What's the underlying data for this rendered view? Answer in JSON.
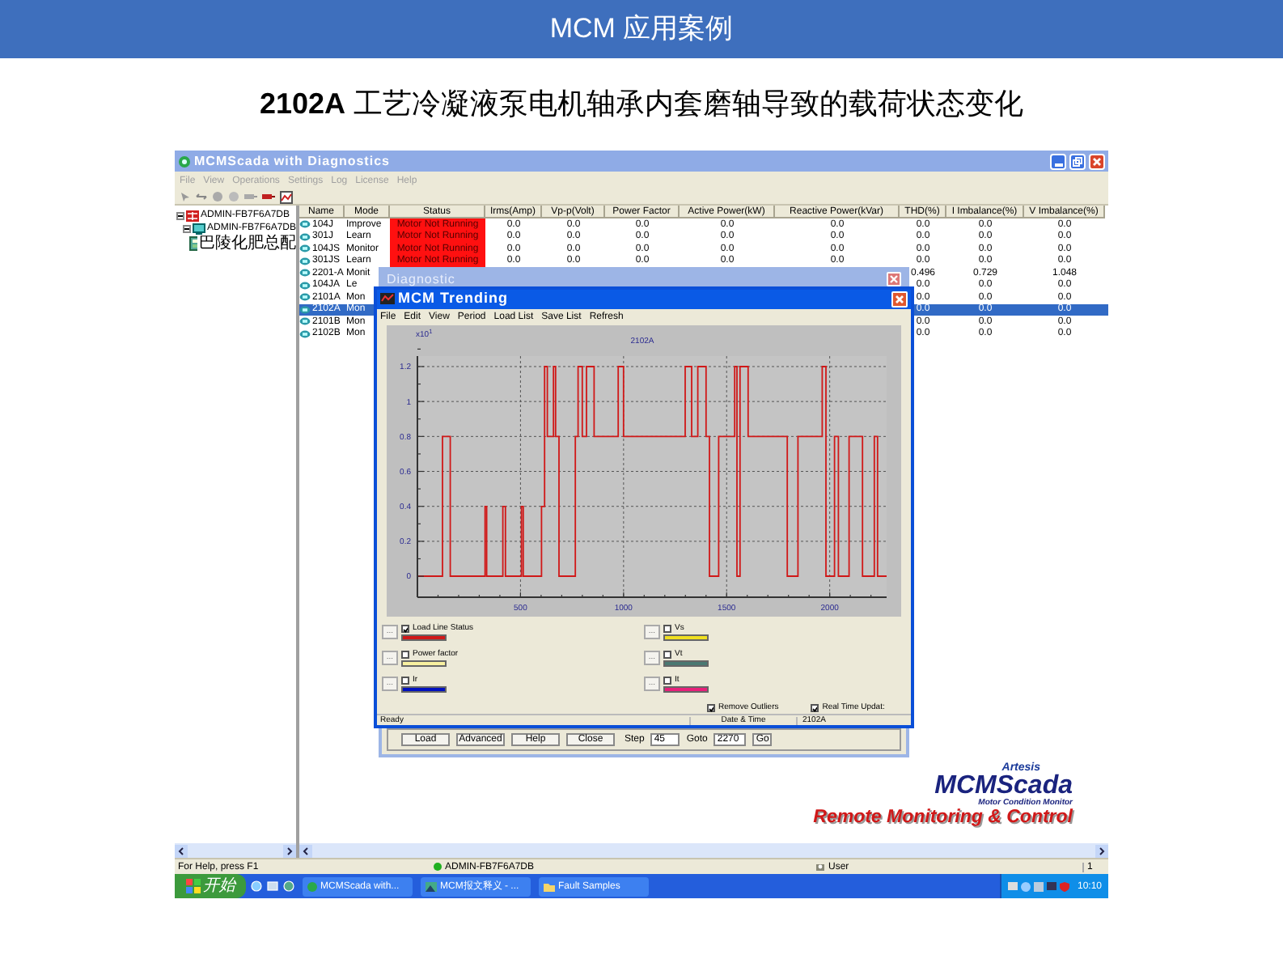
{
  "slide": {
    "title": "MCM 应用案例",
    "subtitle": "**2102A** 工艺冷凝液泵电机轴承内套磨轴导致的载荷状态变化"
  },
  "window": {
    "title": "MCMScada with Diagnostics"
  },
  "menu": [
    {
      "label": "File",
      "disabled": true
    },
    {
      "label": "View",
      "disabled": true
    },
    {
      "label": "Operations",
      "disabled": true
    },
    {
      "label": "Settings",
      "disabled": true
    },
    {
      "label": "Log",
      "disabled": true
    },
    {
      "label": "License",
      "disabled": true
    },
    {
      "label": "Help",
      "disabled": true
    }
  ],
  "tree": [
    {
      "label": "ADMIN-FB7F6A7DB",
      "expanded": true,
      "children": [
        {
          "label": "ADMIN-FB7F6A7DB",
          "expanded": true,
          "children": [
            {
              "label": "巴陵化肥总配"
            }
          ]
        }
      ]
    }
  ],
  "table": {
    "columns": [
      "Name",
      "Mode",
      "Status",
      "Irms(Amp)",
      "Vp-p(Volt)",
      "Power Factor",
      "Active Power(kW)",
      "Reactive Power(kVar)",
      "THD(%)",
      "I Imbalance(%)",
      "V Imbalance(%)"
    ],
    "rows": [
      {
        "name": "104J",
        "mode": "Improve",
        "status": "Motor Not Running",
        "alarm": true,
        "values": [
          "0.0",
          "0.0",
          "0.0",
          "0.0",
          "0.0",
          "0.0",
          "0.0",
          "0.0"
        ],
        "selected": false
      },
      {
        "name": "301J",
        "mode": "Learn",
        "status": "Motor Not Running",
        "alarm": true,
        "values": [
          "0.0",
          "0.0",
          "0.0",
          "0.0",
          "0.0",
          "0.0",
          "0.0",
          "0.0"
        ],
        "selected": false
      },
      {
        "name": "104JS",
        "mode": "Monitor",
        "status": "Motor Not Running",
        "alarm": true,
        "values": [
          "0.0",
          "0.0",
          "0.0",
          "0.0",
          "0.0",
          "0.0",
          "0.0",
          "0.0"
        ],
        "selected": false
      },
      {
        "name": "301JS",
        "mode": "Learn",
        "status": "Motor Not Running",
        "alarm": true,
        "values": [
          "0.0",
          "0.0",
          "0.0",
          "0.0",
          "0.0",
          "0.0",
          "0.0",
          "0.0"
        ],
        "selected": false
      },
      {
        "name": "2201-A",
        "mode": "Monit",
        "tail": [
          "0.496",
          "0.729",
          "1.048"
        ],
        "selected": false
      },
      {
        "name": "104JA",
        "mode": "Le",
        "tail": [
          "0.0",
          "0.0",
          "0.0"
        ],
        "selected": false
      },
      {
        "name": "2101A",
        "mode": "Mon",
        "tail": [
          "0.0",
          "0.0",
          "0.0"
        ],
        "selected": false
      },
      {
        "name": "2102A",
        "mode": "Mon",
        "tail": [
          "0.0",
          "0.0",
          "0.0"
        ],
        "selected": true
      },
      {
        "name": "2101B",
        "mode": "Mon",
        "tail": [
          "0.0",
          "0.0",
          "0.0"
        ],
        "selected": false
      },
      {
        "name": "2102B",
        "mode": "Mon",
        "tail": [
          "0.0",
          "0.0",
          "0.0"
        ],
        "selected": false
      }
    ]
  },
  "diagnostic": {
    "title": "Diagnostic",
    "buttons": [
      "Load",
      "Advanced",
      "Help",
      "Close"
    ],
    "step": {
      "label": "Step",
      "value": "45"
    },
    "goto": {
      "label": "Goto",
      "value": "2270"
    },
    "go": "Go"
  },
  "trending": {
    "title": "MCM Trending",
    "menu": [
      "File",
      "Edit",
      "View",
      "Period",
      "Load List",
      "Save List",
      "Refresh"
    ],
    "chart_data": {
      "type": "line",
      "grid": true,
      "title": "2102A",
      "ylabel": "x10$^{1}$",
      "xlim": [
        0,
        2276
      ],
      "ylim": [
        -0.12,
        1.26
      ],
      "xticks": [
        500,
        1000,
        1500,
        2000
      ],
      "yticks": [
        0,
        0.2,
        0.4,
        0.6,
        0.8,
        1,
        1.2
      ],
      "x": [
        0,
        122,
        122,
        159,
        159,
        328,
        328,
        336,
        336,
        414,
        414,
        427,
        427,
        505,
        505,
        513,
        513,
        602,
        602,
        617,
        617,
        630,
        630,
        660,
        660,
        670,
        670,
        687,
        687,
        766,
        766,
        779,
        779,
        800,
        800,
        820,
        820,
        857,
        857,
        974,
        974,
        1000,
        1000,
        1299,
        1299,
        1330,
        1330,
        1360,
        1360,
        1400,
        1400,
        1417,
        1417,
        1461,
        1461,
        1539,
        1539,
        1550,
        1550,
        1565,
        1565,
        1604,
        1604,
        1794,
        1794,
        1846,
        1846,
        1964,
        1964,
        1982,
        1982,
        2023,
        2023,
        2042,
        2042,
        2094,
        2094,
        2159,
        2159,
        2216,
        2216,
        2232,
        2232,
        2276
      ],
      "series": [
        {
          "color": "#d01818",
          "values": [
            0,
            0,
            0.8,
            0.8,
            0,
            0,
            0.4,
            0.4,
            0,
            0,
            0.4,
            0.4,
            0,
            0,
            0.4,
            0.4,
            0,
            0,
            0.4,
            0.4,
            1.2,
            1.2,
            0.8,
            0.8,
            1.2,
            1.2,
            0.8,
            0.8,
            0,
            0,
            0.8,
            0.8,
            1.2,
            1.2,
            0.8,
            0.8,
            1.2,
            1.2,
            0.8,
            0.8,
            1.2,
            1.2,
            0.8,
            0.8,
            1.2,
            1.2,
            0.8,
            0.8,
            1.2,
            1.2,
            0.8,
            0.8,
            0,
            0,
            0.8,
            0.8,
            1.2,
            1.2,
            0,
            0,
            1.2,
            1.2,
            0.8,
            0.8,
            0,
            0,
            0.8,
            0.8,
            1.2,
            1.2,
            0,
            0,
            0.8,
            0.8,
            0,
            0,
            0.8,
            0.8,
            0,
            0,
            0.8,
            0.8,
            0,
            0
          ]
        }
      ]
    },
    "legend": [
      {
        "button": "...",
        "label": "Load Line Status",
        "checked": true,
        "color": "#d01818"
      },
      {
        "button": "...",
        "label": "Vs",
        "checked": false,
        "color": "#f0e020"
      },
      {
        "button": "...",
        "label": "Power factor",
        "checked": false,
        "color": "#f8f0a0"
      },
      {
        "button": "...",
        "label": "Vt",
        "checked": false,
        "color": "#4a7872"
      },
      {
        "button": "...",
        "label": "Ir",
        "checked": false,
        "color": "#0010c0"
      },
      {
        "button": "...",
        "label": "It",
        "checked": false,
        "color": "#e8207a"
      }
    ],
    "options": [
      {
        "label": "Remove Outliers",
        "checked": true
      },
      {
        "label": "Real Time Updat:",
        "checked": true
      }
    ],
    "status_bar": [
      "Ready",
      "Date & Time",
      "2102A"
    ]
  },
  "logo": {
    "brand": "Artesis",
    "product": "MCMScada",
    "tagline": "Motor Condition Monitor",
    "slogan": "Remote Monitoring & Control"
  },
  "status_bar": {
    "help": "For Help, press F1",
    "host": "ADMIN-FB7F6A7DB",
    "user": "User",
    "pane": "1"
  },
  "taskbar": {
    "start": "开始",
    "tasks": [
      "MCMScada with...",
      "MCM报文释义 - ...",
      "Fault Samples"
    ],
    "clock": "10:10"
  }
}
